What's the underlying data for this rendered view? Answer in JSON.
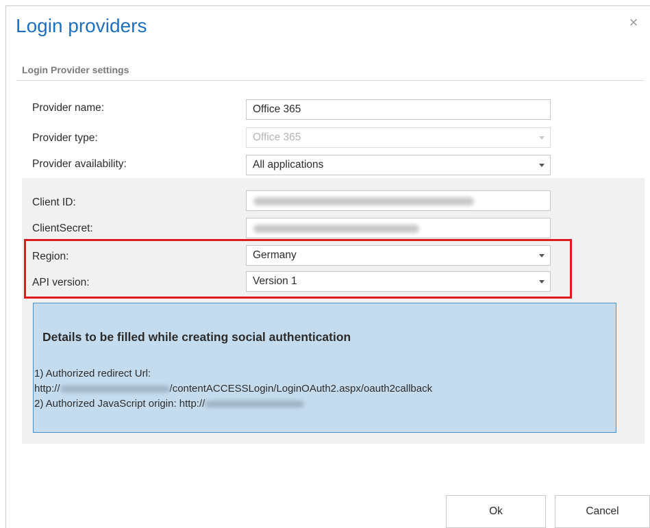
{
  "dialog": {
    "title": "Login providers",
    "close_label": "×",
    "section_title": "Login Provider settings"
  },
  "form": {
    "provider_name": {
      "label": "Provider name:",
      "value": "Office 365"
    },
    "provider_type": {
      "label": "Provider type:",
      "value": "Office 365"
    },
    "provider_availability": {
      "label": "Provider availability:",
      "value": "All applications"
    },
    "client_id": {
      "label": "Client ID:",
      "value": ""
    },
    "client_secret": {
      "label": "ClientSecret:",
      "value": ""
    },
    "region": {
      "label": "Region:",
      "value": "Germany"
    },
    "api_version": {
      "label": "API version:",
      "value": "Version 1"
    }
  },
  "info": {
    "title": "Details to be filled while creating social authentication",
    "line1": "1) Authorized redirect Url:",
    "line2_prefix": "http://",
    "line2_suffix": "/contentACCESSLogin/LoginOAuth2.aspx/oauth2callback",
    "line3_prefix": "2) Authorized JavaScript origin: http://"
  },
  "buttons": {
    "ok": "Ok",
    "cancel": "Cancel"
  },
  "colors": {
    "title": "#1f6fbf",
    "highlight": "#e01b1b",
    "info_bg": "#c5dcee",
    "info_border": "#4a90c8"
  }
}
